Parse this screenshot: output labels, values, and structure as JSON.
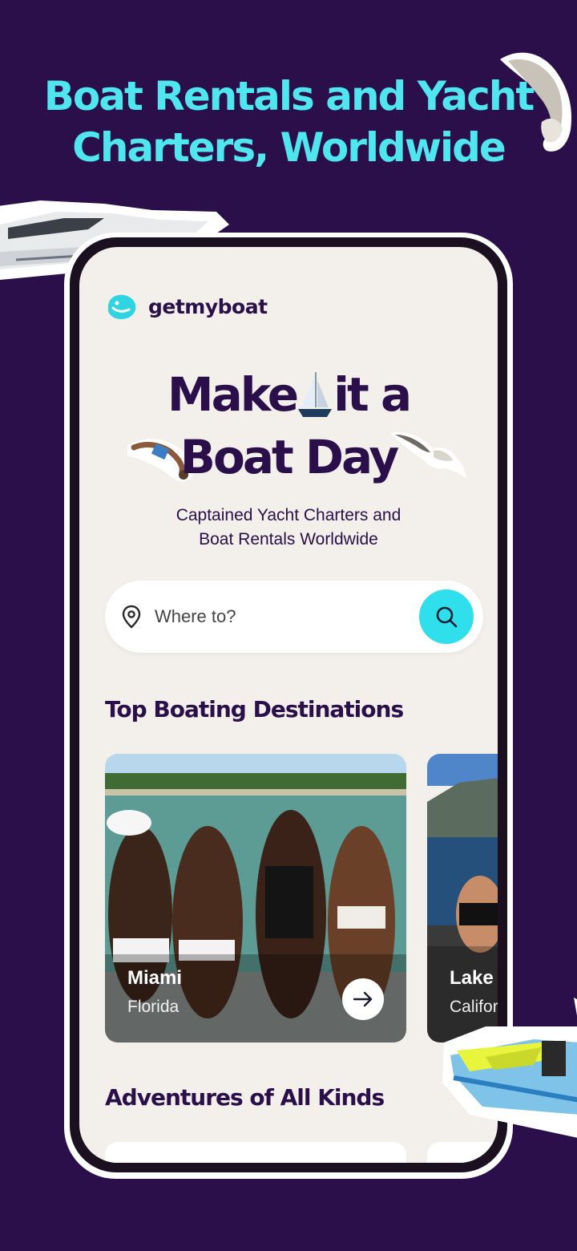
{
  "headline": {
    "line1": "Boat Rentals and Yacht",
    "line2": "Charters, Worldwide"
  },
  "brand": {
    "name": "getmyboat",
    "logo_icon": "whale-logo-icon"
  },
  "hero": {
    "line1_a": "Make",
    "line1_b": "it a",
    "line2": "Boat Day",
    "subtitle_line1": "Captained Yacht Charters and",
    "subtitle_line2": "Boat Rentals Worldwide"
  },
  "search": {
    "placeholder": "Where to?",
    "icon": "map-pin-icon",
    "button_icon": "search-icon"
  },
  "destinations": {
    "title": "Top Boating Destinations",
    "items": [
      {
        "city": "Miami",
        "region": "Florida"
      },
      {
        "city": "Lake",
        "region": "Califor"
      }
    ]
  },
  "adventures": {
    "title": "Adventures of All Kinds"
  },
  "colors": {
    "background": "#2b0f4a",
    "accent": "#4fe6ef",
    "search_button": "#2fe0ec",
    "screen": "#f3f0eb"
  }
}
